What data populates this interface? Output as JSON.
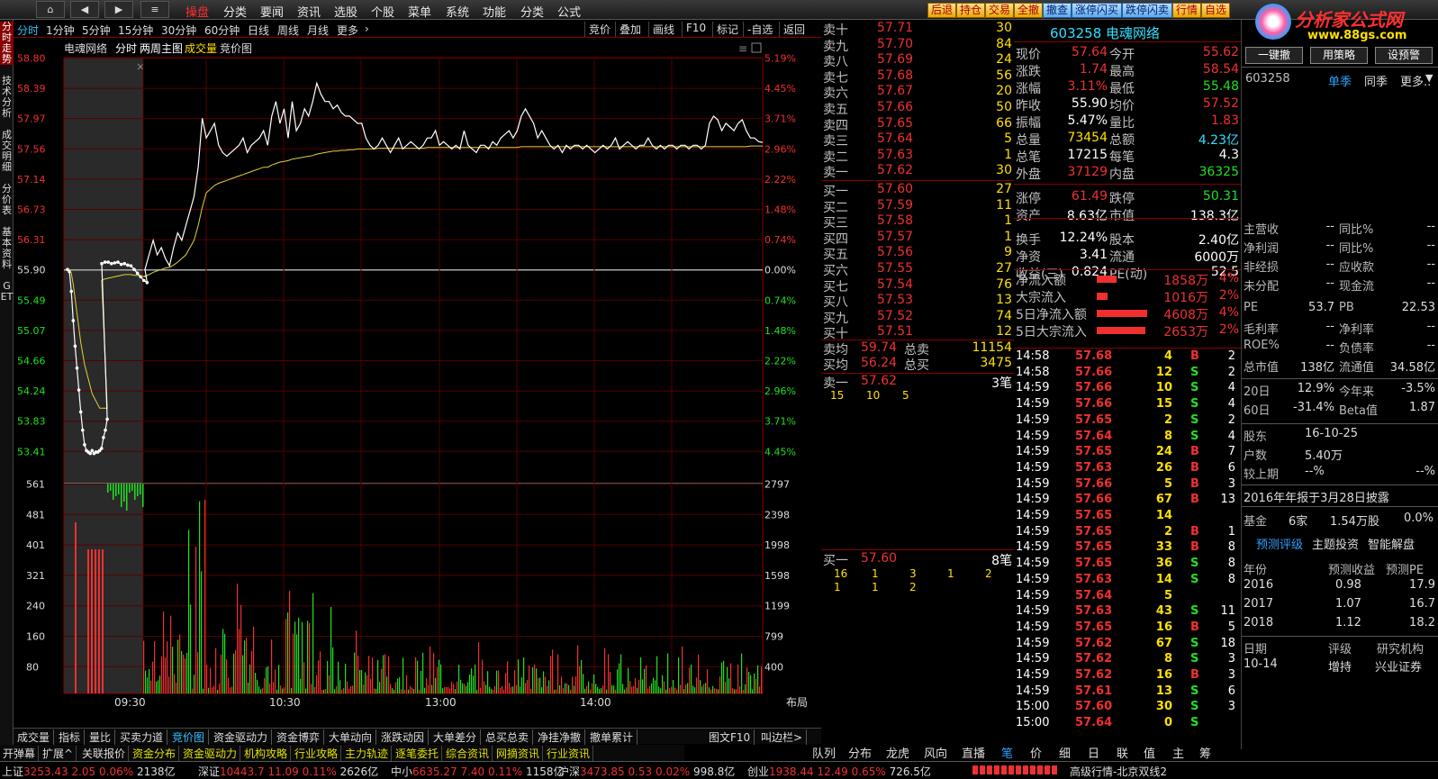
{
  "topbar": {
    "nav": [
      "⌂",
      "◀",
      "▶",
      "≡"
    ],
    "menus": [
      "操盘",
      "分类",
      "要闻",
      "资讯",
      "选股",
      "个股",
      "菜单",
      "系统",
      "功能",
      "分类",
      "公式"
    ],
    "rbtns": [
      "后退",
      "持仓",
      "交易",
      "全撤",
      "撤查",
      "涨停闪买",
      "跌停闪卖",
      "行情",
      "自选"
    ],
    "logo": "分析家公式网",
    "logo_url": "www.88gs.com"
  },
  "leftbar": [
    "分时走势",
    "技术分析",
    "成交明细",
    "分价表",
    "基本资料",
    "GET"
  ],
  "periods": [
    "分时",
    "1分钟",
    "5分钟",
    "15分钟",
    "30分钟",
    "60分钟",
    "日线",
    "周线",
    "月线",
    "更多"
  ],
  "toolbtns": [
    "竞价",
    "叠加",
    "画线",
    "F10",
    "标记",
    "-自选",
    "返回"
  ],
  "chart": {
    "name": "电魂网络",
    "tabs": [
      "分时",
      "两周主图",
      "成交量",
      "竞价图"
    ],
    "yleft": [
      "58.80",
      "58.39",
      "57.97",
      "57.56",
      "57.14",
      "56.73",
      "56.31",
      "55.90",
      "55.49",
      "55.07",
      "54.66",
      "54.24",
      "53.83",
      "53.41"
    ],
    "yright": [
      "5.19%",
      "4.45%",
      "3.71%",
      "2.96%",
      "2.22%",
      "1.48%",
      "0.74%",
      "0.00%",
      "0.74%",
      "1.48%",
      "2.22%",
      "2.96%",
      "3.71%",
      "4.45%"
    ],
    "vleft": [
      "561",
      "481",
      "401",
      "321",
      "240",
      "160",
      "80"
    ],
    "vright": [
      "2797",
      "2398",
      "1998",
      "1598",
      "1199",
      "799",
      "400"
    ],
    "times": [
      "09:30",
      "10:30",
      "13:00",
      "14:00"
    ],
    "layout": "布局",
    "price": [
      55.9,
      55.87,
      55.6,
      55.2,
      54.85,
      54.55,
      54.25,
      53.95,
      53.7,
      53.5,
      53.42,
      53.4,
      53.38,
      53.42,
      53.38,
      53.4,
      53.4,
      53.42,
      53.45,
      53.6,
      53.7,
      53.85,
      55.98,
      56.0,
      56.0,
      55.98,
      55.99,
      56.0,
      55.97,
      55.98,
      55.96,
      55.95,
      55.9,
      55.85,
      55.8,
      55.75,
      55.72,
      55.9,
      56.1,
      56.3,
      56.1,
      56.2,
      56.05,
      55.95,
      56.2,
      56.4,
      56.3,
      56.5,
      56.7,
      56.9,
      57.3,
      57.97,
      57.7,
      57.8,
      57.9,
      57.6,
      57.5,
      57.45,
      57.5,
      57.55,
      57.6,
      57.7,
      57.5,
      57.6,
      57.65,
      57.7,
      57.8,
      57.6,
      58.0,
      58.2,
      57.9,
      58.1,
      57.7,
      58.2,
      57.8,
      57.9,
      58.1,
      58.0,
      58.2,
      58.45,
      58.3,
      58.2,
      58.2,
      58.1,
      58.15,
      58.05,
      58.0,
      58.0,
      57.95,
      57.9,
      57.9,
      57.7,
      57.6,
      57.55,
      57.6,
      57.7,
      57.6,
      57.5,
      57.6,
      57.7,
      57.55,
      57.6,
      57.65,
      57.6,
      57.55,
      57.6,
      57.7,
      57.7,
      57.8,
      57.6,
      57.65,
      57.6,
      57.55,
      57.6,
      57.55,
      57.8,
      57.6,
      57.55,
      57.5,
      57.6,
      57.6,
      57.55,
      57.65,
      57.6,
      57.7,
      57.75,
      57.8,
      57.7,
      57.8,
      58.0,
      58.1,
      58.0,
      57.9,
      57.7,
      57.8,
      57.7,
      57.6,
      57.55,
      57.6,
      57.5,
      57.6,
      57.55,
      57.6,
      57.6,
      57.55,
      57.6,
      57.55,
      57.5,
      57.55,
      57.6,
      57.55,
      57.6,
      57.7,
      57.55,
      57.6,
      57.65,
      57.6,
      57.55,
      57.6,
      57.6,
      57.7,
      57.6,
      57.55,
      57.6,
      57.55,
      57.6,
      57.6,
      57.55,
      57.6,
      57.6,
      57.55,
      57.6,
      57.6,
      57.55,
      57.6,
      57.9,
      58.0,
      57.95,
      57.8,
      57.9,
      57.85,
      57.8,
      57.9,
      57.95,
      57.8,
      57.7,
      57.7,
      57.65,
      57.64
    ],
    "avg": [
      55.9,
      55.9,
      55.85,
      55.7,
      55.5,
      55.3,
      55.1,
      54.9,
      54.75,
      54.6,
      54.5,
      54.4,
      54.3,
      54.2,
      54.15,
      54.1,
      54.05,
      54.0,
      54.0,
      54.0,
      54.0,
      54.0,
      55.75,
      55.77,
      55.78,
      55.79,
      55.8,
      55.81,
      55.82,
      55.83,
      55.83,
      55.83,
      55.82,
      55.82,
      55.81,
      55.8,
      55.8,
      55.81,
      55.83,
      55.86,
      55.88,
      55.9,
      55.92,
      55.93,
      55.96,
      56.0,
      56.05,
      56.1,
      56.2,
      56.3,
      56.5,
      56.75,
      56.95,
      57.0,
      57.05,
      57.08,
      57.1,
      57.12,
      57.14,
      57.16,
      57.18,
      57.2,
      57.22,
      57.24,
      57.26,
      57.28,
      57.3,
      57.3,
      57.33,
      57.35,
      57.37,
      57.38,
      57.39,
      57.41,
      57.42,
      57.43,
      57.44,
      57.45,
      57.46,
      57.48,
      57.49,
      57.5,
      57.51,
      57.52,
      57.52,
      57.53,
      57.53,
      57.54,
      57.54,
      57.55,
      57.55,
      57.55,
      57.55,
      57.55,
      57.56,
      57.56,
      57.56,
      57.56,
      57.56,
      57.56,
      57.56,
      57.56,
      57.56,
      57.56,
      57.56,
      57.56,
      57.57,
      57.57,
      57.57,
      57.57,
      57.57,
      57.57,
      57.57,
      57.57,
      57.57,
      57.57,
      57.57,
      57.57,
      57.57,
      57.57,
      57.57,
      57.57,
      57.57,
      57.57,
      57.57,
      57.57,
      57.57,
      57.57,
      57.57,
      57.58,
      57.58,
      57.58,
      57.58,
      57.58,
      57.58,
      57.58,
      57.58,
      57.58,
      57.58,
      57.58,
      57.58,
      57.58,
      57.58,
      57.58,
      57.58,
      57.58,
      57.58,
      57.58,
      57.58,
      57.58,
      57.58,
      57.58,
      57.58,
      57.58,
      57.58,
      57.58,
      57.58,
      57.58,
      57.58,
      57.58,
      57.58,
      57.58,
      57.58,
      57.58,
      57.58,
      57.58,
      57.58,
      57.58,
      57.58,
      57.58,
      57.58,
      57.58,
      57.58,
      57.58,
      57.58,
      57.58,
      57.58,
      57.58,
      57.58,
      57.58,
      57.58,
      57.58,
      57.58,
      57.58,
      57.58,
      57.59,
      57.59,
      57.59,
      57.59
    ]
  },
  "book": {
    "asks": [
      [
        "卖十",
        "57.71",
        "30"
      ],
      [
        "卖九",
        "57.70",
        "84"
      ],
      [
        "卖八",
        "57.69",
        "24"
      ],
      [
        "卖七",
        "57.68",
        "56"
      ],
      [
        "卖六",
        "57.67",
        "20"
      ],
      [
        "卖五",
        "57.66",
        "50"
      ],
      [
        "卖四",
        "57.65",
        "66"
      ],
      [
        "卖三",
        "57.64",
        "5"
      ],
      [
        "卖二",
        "57.63",
        "1"
      ],
      [
        "卖一",
        "57.62",
        "30"
      ]
    ],
    "bids": [
      [
        "买一",
        "57.60",
        "27"
      ],
      [
        "买二",
        "57.59",
        "11"
      ],
      [
        "买三",
        "57.58",
        "1"
      ],
      [
        "买四",
        "57.57",
        "1"
      ],
      [
        "买五",
        "57.56",
        "9"
      ],
      [
        "买六",
        "57.55",
        "27"
      ],
      [
        "买七",
        "57.54",
        "76"
      ],
      [
        "买八",
        "57.53",
        "13"
      ],
      [
        "买九",
        "57.52",
        "74"
      ],
      [
        "买十",
        "57.51",
        "12"
      ]
    ],
    "avg": [
      [
        "卖均",
        "59.74",
        "总卖",
        "11154"
      ],
      [
        "买均",
        "56.24",
        "总买",
        "3475"
      ]
    ],
    "sell1": {
      "label": "卖一",
      "price": "57.62",
      "cnt": "3笔",
      "q": [
        "15",
        "10",
        "5"
      ]
    },
    "buy1": {
      "label": "买一",
      "price": "57.60",
      "cnt": "8笔",
      "q": [
        "16",
        "1",
        "3",
        "1",
        "2",
        "1",
        "1",
        "2"
      ]
    }
  },
  "quote": {
    "code": "603258",
    "name": "电魂网络",
    "rows": [
      [
        "现价",
        "57.64",
        "今开",
        "55.62"
      ],
      [
        "涨跌",
        "1.74",
        "最高",
        "58.54"
      ],
      [
        "涨幅",
        "3.11%",
        "最低",
        "55.48"
      ],
      [
        "昨收",
        "55.90",
        "均价",
        "57.52"
      ],
      [
        "振幅",
        "5.47%",
        "量比",
        "1.83"
      ],
      [
        "总量",
        "73454",
        "总额",
        "4.23亿"
      ],
      [
        "总笔",
        "17215",
        "每笔",
        "4.3"
      ],
      [
        "外盘",
        "37129",
        "内盘",
        "36325"
      ],
      [
        "涨停",
        "61.49",
        "跌停",
        "50.31"
      ],
      [
        "资产",
        "8.63亿",
        "市值",
        "138.3亿"
      ],
      [
        "换手",
        "12.24%",
        "股本",
        "2.40亿"
      ],
      [
        "净资",
        "3.41",
        "流通",
        "6000万"
      ],
      [
        "收益(三)",
        "0.824",
        "PE(动)",
        "52.5"
      ]
    ],
    "flow": [
      [
        "净流入额",
        "1858万",
        "4%"
      ],
      [
        "大宗流入",
        "1016万",
        "2%"
      ],
      [
        "5日净流入额",
        "4608万",
        "4%"
      ],
      [
        "5日大宗流入",
        "2653万",
        "2%"
      ]
    ]
  },
  "trades": [
    [
      "14:58",
      "57.68",
      "4",
      "B",
      "2"
    ],
    [
      "14:58",
      "57.66",
      "12",
      "S",
      "2"
    ],
    [
      "14:59",
      "57.66",
      "10",
      "S",
      "4"
    ],
    [
      "14:59",
      "57.66",
      "15",
      "S",
      "4"
    ],
    [
      "14:59",
      "57.65",
      "2",
      "S",
      "2"
    ],
    [
      "14:59",
      "57.64",
      "8",
      "S",
      "4"
    ],
    [
      "14:59",
      "57.65",
      "24",
      "B",
      "7"
    ],
    [
      "14:59",
      "57.63",
      "26",
      "B",
      "6"
    ],
    [
      "14:59",
      "57.66",
      "5",
      "B",
      "3"
    ],
    [
      "14:59",
      "57.66",
      "67",
      "B",
      "13"
    ],
    [
      "14:59",
      "57.65",
      "14",
      "",
      ""
    ],
    [
      "14:59",
      "57.65",
      "2",
      "B",
      "1"
    ],
    [
      "14:59",
      "57.65",
      "33",
      "B",
      "8"
    ],
    [
      "14:59",
      "57.65",
      "36",
      "S",
      "8"
    ],
    [
      "14:59",
      "57.63",
      "14",
      "S",
      "8"
    ],
    [
      "14:59",
      "57.64",
      "5",
      "",
      ""
    ],
    [
      "14:59",
      "57.63",
      "43",
      "S",
      "11"
    ],
    [
      "14:59",
      "57.65",
      "16",
      "B",
      "5"
    ],
    [
      "14:59",
      "57.62",
      "67",
      "S",
      "18"
    ],
    [
      "14:59",
      "57.62",
      "8",
      "S",
      "3"
    ],
    [
      "14:59",
      "57.62",
      "16",
      "B",
      "3"
    ],
    [
      "14:59",
      "57.61",
      "13",
      "S",
      "6"
    ],
    [
      "15:00",
      "57.60",
      "30",
      "S",
      "3"
    ],
    [
      "15:00",
      "57.64",
      "0",
      "S",
      ""
    ]
  ],
  "side": {
    "btns": [
      "一键撤",
      "用策略",
      "设预警"
    ],
    "code": "603258",
    "tabs": [
      "单季",
      "同季",
      "更多.."
    ],
    "fin": [
      [
        "主营收",
        "--",
        "同比%",
        "--"
      ],
      [
        "净利润",
        "--",
        "同比%",
        "--"
      ],
      [
        "非经损",
        "--",
        "应收款",
        "--"
      ],
      [
        "未分配",
        "--",
        "现金流",
        "--"
      ]
    ],
    "val": [
      [
        "PE",
        "53.7",
        "PB",
        "22.53"
      ],
      [
        "毛利率",
        "--",
        "净利率",
        "--"
      ],
      [
        "ROE%",
        "--",
        "负债率",
        "--"
      ],
      [
        "总市值",
        "138亿",
        "流通值",
        "34.58亿"
      ]
    ],
    "perf": [
      [
        "20日",
        "12.9%",
        "今年来",
        "-3.5%"
      ],
      [
        "60日",
        "-31.4%",
        "Beta值",
        "1.87"
      ]
    ],
    "holder": [
      [
        "股东",
        "16-10-25"
      ],
      [
        "户数",
        "5.40万"
      ],
      [
        "较上期",
        "--%",
        "--%"
      ]
    ],
    "report": "2016年年报于3月28日披露",
    "fund": [
      "基金",
      "6家",
      "1.54万股",
      "0.0%"
    ],
    "fc_tabs": [
      "预测评级",
      "主题投资",
      "智能解盘"
    ],
    "fc_head": [
      "年份",
      "预测收益",
      "预测PE"
    ],
    "fc": [
      [
        "2016",
        "0.98",
        "17.9"
      ],
      [
        "2017",
        "1.07",
        "16.7"
      ],
      [
        "2018",
        "1.12",
        "18.2"
      ]
    ],
    "rt_head": [
      "日期",
      "评级",
      "研究机构"
    ],
    "rt": [
      "10-14",
      "增持",
      "兴业证券"
    ]
  },
  "bottabs": [
    "成交量",
    "指标",
    "量比",
    "买卖力道",
    "竞价图",
    "资金驱动力",
    "资金博弈",
    "大单动向",
    "涨跌动因",
    "大单差分",
    "总买总卖",
    "净挂净撤",
    "撤单累计"
  ],
  "bottabs_r": [
    "图文F10",
    "叫边栏>"
  ],
  "tabs2": [
    "开弹幕",
    "扩展^",
    "关联报价",
    "资金分布",
    "资金驱动力",
    "机构攻略",
    "行业攻略",
    "主力轨迹",
    "逐笔委托",
    "综合资讯",
    "网摘资讯",
    "行业资讯"
  ],
  "ctabs": [
    "队列",
    "分布",
    "龙虎",
    "风向",
    "直播",
    "笔",
    "价",
    "细",
    "日",
    "联",
    "值",
    "主",
    "筹"
  ],
  "status": [
    [
      "上证",
      "3253.43",
      "2.05",
      "0.06%",
      "2138亿"
    ],
    [
      "深证",
      "10443.7",
      "11.09",
      "0.11%",
      "2626亿"
    ],
    [
      "中小",
      "6635.27",
      "7.40",
      "0.11%",
      "1158亿"
    ],
    [
      "沪深",
      "3473.85",
      "0.53",
      "0.02%",
      "998.8亿"
    ],
    [
      "创业",
      "1938.44",
      "12.49",
      "0.65%",
      "726.5亿"
    ]
  ],
  "status_r": "高级行情-北京双线2"
}
